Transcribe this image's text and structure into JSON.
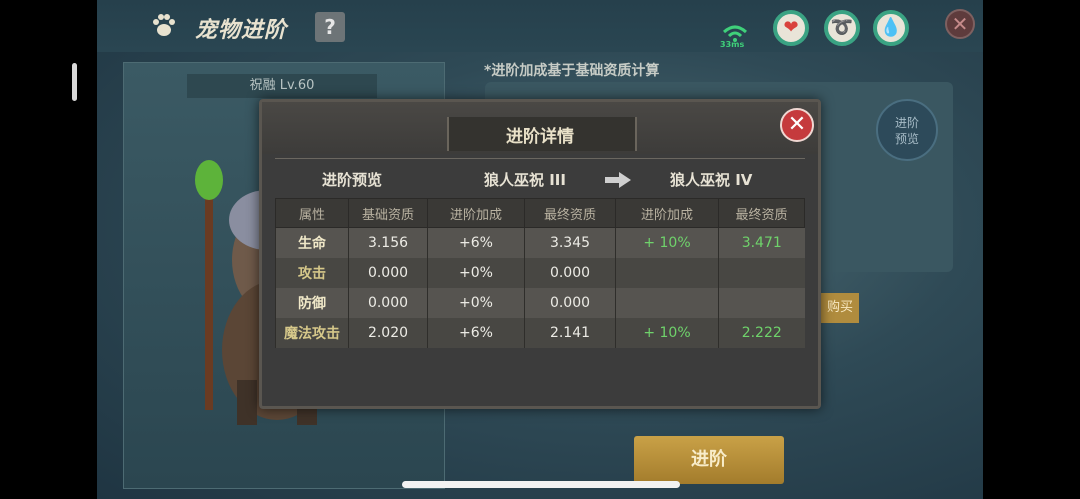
{
  "topbar": {
    "title": "宠物进阶",
    "help": "?",
    "ping": "33ms",
    "status_icons": [
      "heart-icon",
      "stamina-icon",
      "water-icon"
    ],
    "close": "✕"
  },
  "pet_panel": {
    "pet_name": "祝融 Lv.60"
  },
  "background_panel": {
    "note": "*进阶加成基于基础资质计算",
    "preview_button": [
      "进阶",
      "预览"
    ],
    "buy": "购买",
    "advance_button": "进阶"
  },
  "modal": {
    "title": "进阶详情",
    "close": "✕",
    "preview_label": "进阶预览",
    "from_name": "狼人巫祝 III",
    "to_name": "狼人巫祝 IV",
    "headers": [
      "属性",
      "基础资质",
      "进阶加成",
      "最终资质",
      "进阶加成",
      "最终资质"
    ],
    "rows": [
      {
        "attr": "生命",
        "base": "3.156",
        "bonus": "+6%",
        "final": "3.345",
        "next_bonus": "+ 10%",
        "next_final": "3.471"
      },
      {
        "attr": "攻击",
        "base": "0.000",
        "bonus": "+0%",
        "final": "0.000",
        "next_bonus": "",
        "next_final": ""
      },
      {
        "attr": "防御",
        "base": "0.000",
        "bonus": "+0%",
        "final": "0.000",
        "next_bonus": "",
        "next_final": ""
      },
      {
        "attr": "魔法攻击",
        "base": "2.020",
        "bonus": "+6%",
        "final": "2.141",
        "next_bonus": "+ 10%",
        "next_final": "2.222"
      }
    ]
  },
  "colors": {
    "accent_green": "#6fd36b",
    "close_red": "#c53a3d",
    "gold_button": "#c9a147"
  }
}
